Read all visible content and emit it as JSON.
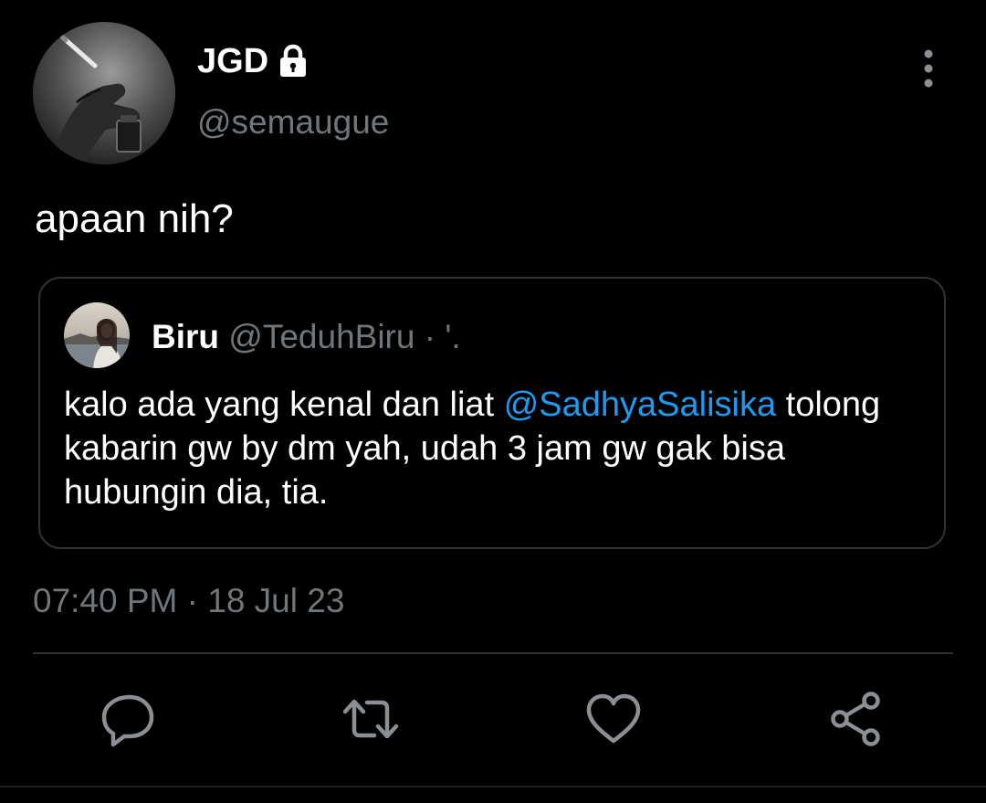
{
  "author": {
    "display_name": "JGD",
    "handle": "@semaugue",
    "icon": "lock-icon"
  },
  "tweet": {
    "text": "apaan nih?",
    "timestamp": "07:40 PM · 18 Jul 23"
  },
  "quoted_tweet": {
    "display_name": "Biru",
    "handle": "@TeduhBiru · '.",
    "text_before_mention": "kalo ada yang kenal dan liat ",
    "mention": "@SadhyaSalisika",
    "text_after_mention": " tolong kabarin gw by dm yah, udah 3 jam gw gak bisa hubungin dia, tia."
  },
  "actions": {
    "reply_icon": "reply-icon",
    "retweet_icon": "retweet-icon",
    "like_icon": "heart-icon",
    "share_icon": "share-icon"
  },
  "colors": {
    "background": "#000000",
    "primary_text": "#ffffff",
    "secondary_text": "#71767b",
    "link": "#1d9bf0",
    "border": "#2f3336"
  }
}
